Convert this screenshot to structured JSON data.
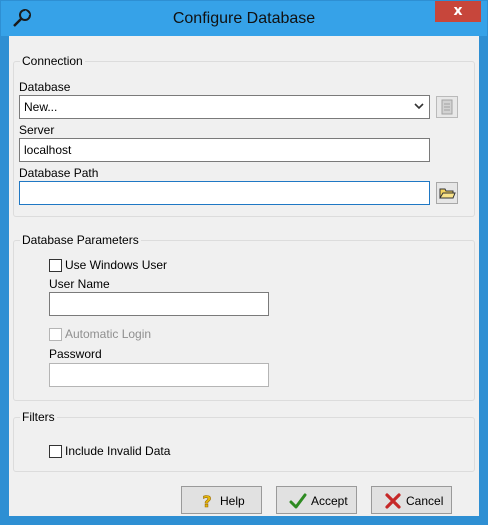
{
  "window": {
    "title": "Configure Database",
    "close_glyph": "x",
    "app_icon": "wrench-icon"
  },
  "connection": {
    "group_label": "Connection",
    "database_label": "Database",
    "database_value": "New...",
    "server_label": "Server",
    "server_value": "localhost",
    "path_label": "Database Path",
    "path_value": ""
  },
  "parameters": {
    "group_label": "Database Parameters",
    "use_windows_user_label": "Use Windows User",
    "use_windows_user_checked": false,
    "user_name_label": "User Name",
    "user_name_value": "",
    "auto_login_label": "Automatic Login",
    "auto_login_enabled": false,
    "password_label": "Password",
    "password_value": ""
  },
  "filters": {
    "group_label": "Filters",
    "include_invalid_label": "Include Invalid Data",
    "include_invalid_checked": false
  },
  "buttons": {
    "help": "Help",
    "accept": "Accept",
    "cancel": "Cancel"
  },
  "colors": {
    "titlebar": "#36a2e8",
    "close": "#c7463b",
    "client": "#f0f0f0"
  }
}
